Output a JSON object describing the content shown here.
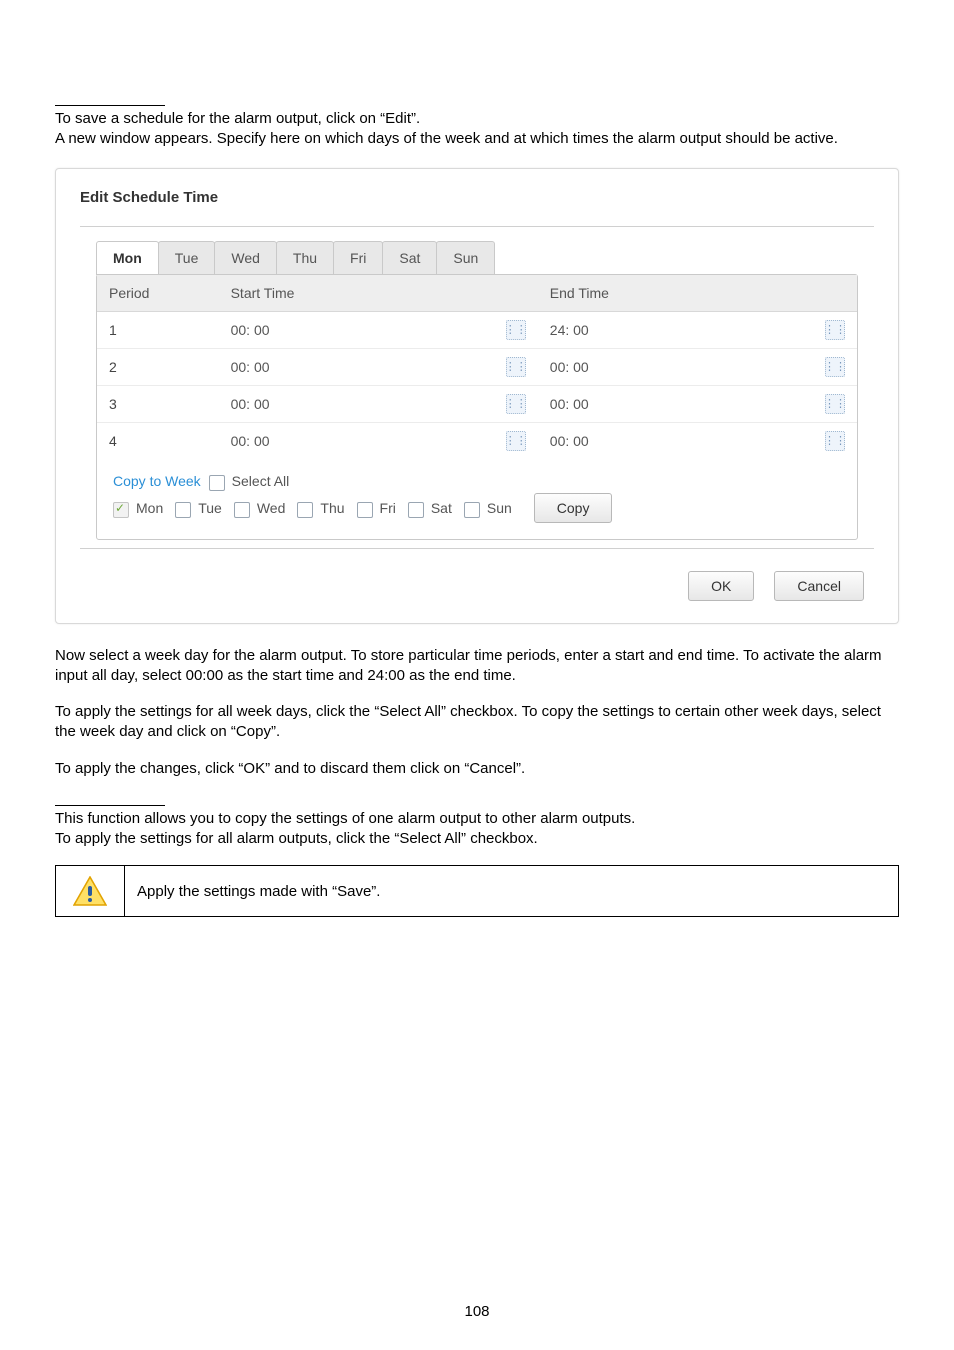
{
  "intro": {
    "line1": "To save a schedule for the alarm output, click on “Edit”.",
    "line2": "A new window appears. Specify here on which days of the week and at which times the alarm output should be active."
  },
  "dialog": {
    "title": "Edit Schedule Time",
    "tabs": [
      "Mon",
      "Tue",
      "Wed",
      "Thu",
      "Fri",
      "Sat",
      "Sun"
    ],
    "headers": {
      "period": "Period",
      "start": "Start Time",
      "end": "End Time"
    },
    "rows": [
      {
        "period": "1",
        "start": "00: 00",
        "end": "24: 00"
      },
      {
        "period": "2",
        "start": "00: 00",
        "end": "00: 00"
      },
      {
        "period": "3",
        "start": "00: 00",
        "end": "00: 00"
      },
      {
        "period": "4",
        "start": "00: 00",
        "end": "00: 00"
      }
    ],
    "copy_to_week": "Copy to Week",
    "select_all": "Select All",
    "days": [
      "Mon",
      "Tue",
      "Wed",
      "Thu",
      "Fri",
      "Sat",
      "Sun"
    ],
    "copy_btn": "Copy",
    "ok_btn": "OK",
    "cancel_btn": "Cancel"
  },
  "body": {
    "p1": "Now select a week day for the alarm output. To store particular time periods, enter a start and end time. To activate the alarm input all day, select 00:00 as the start time and 24:00 as the end time.",
    "p2": "To apply the settings for all week days, click the “Select All” checkbox. To copy the settings to certain other week days, select the week day and click on “Copy”.",
    "p3": "To apply the changes, click “OK” and to discard them click on “Cancel”.",
    "p4": "This function allows you to copy the settings of one alarm output to other alarm outputs.",
    "p5": "To apply the settings for all alarm outputs, click the “Select All” checkbox."
  },
  "note": "Apply the settings made with “Save”.",
  "page_number": "108"
}
